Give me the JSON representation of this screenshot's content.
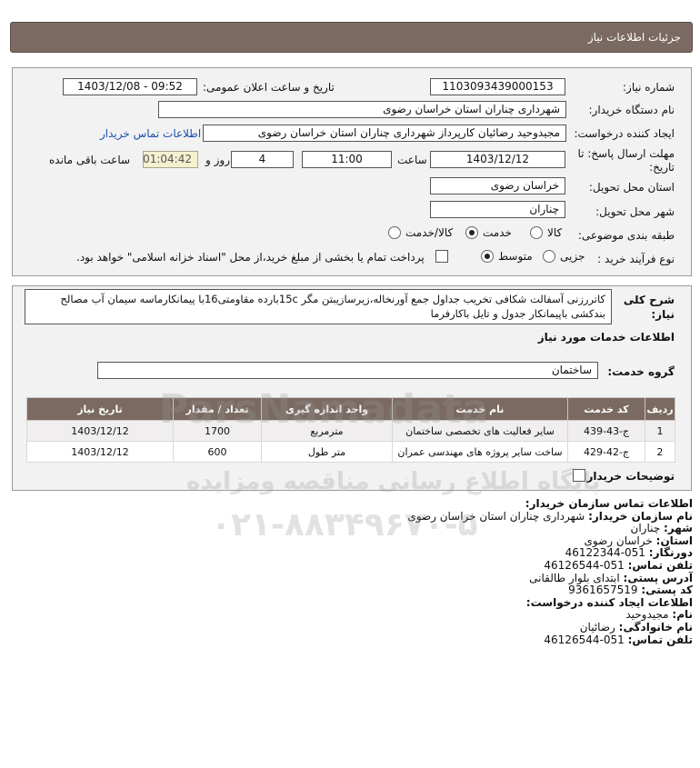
{
  "header": {
    "title": "جزئیات اطلاعات نیاز"
  },
  "fields": {
    "need_number_label": "شماره نیاز:",
    "need_number": "1103093439000153",
    "announce_label": "تاریخ و ساعت اعلان عمومی:",
    "announce_value": "1403/12/08 - 09:52",
    "buyer_org_label": "نام دستگاه خریدار:",
    "buyer_org": "شهرداری چناران استان خراسان رضوی",
    "requester_label": "ایجاد کننده درخواست:",
    "requester": "مجیدوحید رضائیان کارپرداز شهرداری چناران استان خراسان رضوی",
    "contact_link": "اطلاعات تماس خریدار",
    "deadline_label_1": "مهلت ارسال پاسخ: تا",
    "deadline_label_2": "تاریخ:",
    "deadline_date": "1403/12/12",
    "time_label": "ساعت",
    "deadline_time": "11:00",
    "days_value": "4",
    "days_label": "روز و",
    "remaining_time": "01:04:42",
    "remaining_label": "ساعت باقی مانده",
    "province_label": "استان محل تحویل:",
    "province": "خراسان رضوی",
    "city_label": "شهر محل تحویل:",
    "city": "چناران",
    "category_label": "طبقه بندی موضوعی:",
    "category_options": [
      "کالا",
      "خدمت",
      "کالا/خدمت"
    ],
    "category_selected": "خدمت",
    "process_label": "نوع فرآیند خرید :",
    "process_options": [
      "جزیی",
      "متوسط"
    ],
    "process_selected": "متوسط",
    "payment_note": "پرداخت تمام یا بخشی از مبلغ خرید،از محل \"اسناد خزانه اسلامی\" خواهد بود."
  },
  "description": {
    "label_1": "شرح کلی",
    "label_2": "نیاز:",
    "text_line1": "کاتررزنی آسفالت شکافی تخریب جداول جمع آورنخاله،زیرسازیبتن مگر 15cبارده مقاومتی16با پیمانکارماسه سیمان آب مصالح",
    "text_line2": "بندکشی باپیمانکار جدول و تایل باکارفرما"
  },
  "services": {
    "section_title": "اطلاعات خدمات مورد نیاز",
    "group_label": "گروه خدمت:",
    "group_value": "ساختمان",
    "columns": [
      "ردیف",
      "کد خدمت",
      "نام خدمت",
      "واحد اندازه گیری",
      "تعداد / مقدار",
      "تاریخ نیاز"
    ],
    "rows": [
      [
        "1",
        "ج-43-439",
        "سایر فعالیت های تخصصی ساختمان",
        "مترمربع",
        "1700",
        "1403/12/12"
      ],
      [
        "2",
        "ج-42-429",
        "ساخت سایر پروژه های مهندسی عمران",
        "متر طول",
        "600",
        "1403/12/12"
      ]
    ],
    "buyer_notes_label": "توضیحات خریدار:"
  },
  "contact": {
    "title": "اطلاعات تماس سازمان خریدار:",
    "org_name_key": "نام سازمان خریدار:",
    "org_name": "شهرداری چناران استان خراسان رضوی",
    "city_key": "شهر:",
    "city": "چناران",
    "province_key": "استان:",
    "province": "خراسان رضوی",
    "fax_key": "دورنگار:",
    "fax": "051-46122344",
    "phone_key": "تلفن تماس:",
    "phone": "051-46126544",
    "address_key": "آدرس پستی:",
    "address": "ابتدای بلوار طالقانی",
    "postal_key": "کد پستی:",
    "postal": "9361657519",
    "creator_title": "اطلاعات ایجاد کننده درخواست:",
    "first_name_key": "نام:",
    "first_name": "مجیدوحید",
    "last_name_key": "نام خانوادگی:",
    "last_name": "رضائیان",
    "creator_phone_key": "تلفن تماس:",
    "creator_phone": "051-46126544"
  },
  "watermark": {
    "brand": "ParsNamadata",
    "tagline": "پایگاه اطلاع رسانی مناقصه ومزایده",
    "phone": "۰۲۱-۸۸۳۴۹۶۷۰-۵"
  }
}
